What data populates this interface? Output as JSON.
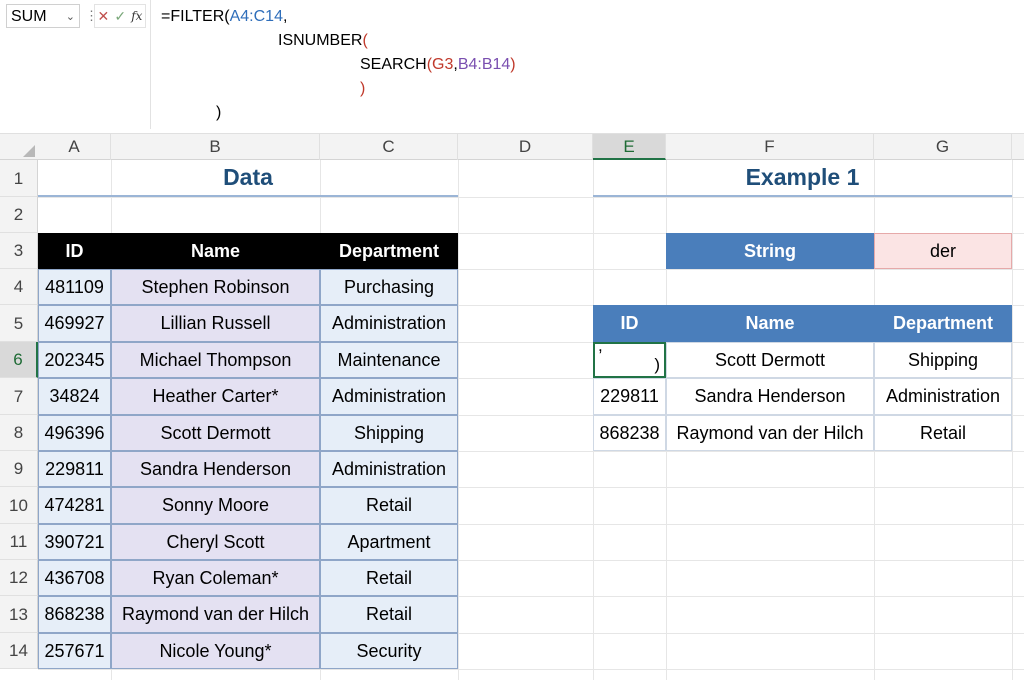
{
  "formula_bar": {
    "name_box": "SUM",
    "cancel_icon": "✕",
    "enter_icon": "✓",
    "fx_label": "fx",
    "formula_lines": {
      "l1a": "=FILTER(",
      "l1b": "A4:C14",
      "l1c": ",",
      "l2a": "ISNUMBER",
      "l2b": "(",
      "l3a": "SEARCH",
      "l3b": "(",
      "l3c": "G3",
      "l3d": ",",
      "l3e": "B4:B14",
      "l3f": ")",
      "l4": ")",
      "l5": ")"
    }
  },
  "columns": [
    "A",
    "B",
    "C",
    "D",
    "E",
    "F",
    "G"
  ],
  "selected_column": "E",
  "rows": [
    "1",
    "2",
    "3",
    "4",
    "5",
    "6",
    "7",
    "8",
    "9",
    "10",
    "11",
    "12",
    "13",
    "14"
  ],
  "selected_row": "6",
  "data_table": {
    "title": "Data",
    "headers": [
      "ID",
      "Name",
      "Department"
    ],
    "rows": [
      [
        "481109",
        "Stephen Robinson",
        "Purchasing"
      ],
      [
        "469927",
        "Lillian Russell",
        "Administration"
      ],
      [
        "202345",
        "Michael Thompson",
        "Maintenance"
      ],
      [
        "34824",
        "Heather Carter*",
        "Administration"
      ],
      [
        "496396",
        "Scott Dermott",
        "Shipping"
      ],
      [
        "229811",
        "Sandra Henderson",
        "Administration"
      ],
      [
        "474281",
        "Sonny Moore",
        "Retail"
      ],
      [
        "390721",
        "Cheryl Scott",
        "Apartment"
      ],
      [
        "436708",
        "Ryan Coleman*",
        "Retail"
      ],
      [
        "868238",
        "Raymond van der Hilch",
        "Retail"
      ],
      [
        "257671",
        "Nicole Young*",
        "Security"
      ]
    ]
  },
  "example": {
    "title": "Example 1",
    "string_label": "String",
    "string_value": "der",
    "headers": [
      "ID",
      "Name",
      "Department"
    ],
    "editing_cell_text_top": ",",
    "editing_cell_text_bottom": ")",
    "rows": [
      [
        "",
        "Scott Dermott",
        "Shipping"
      ],
      [
        "229811",
        "Sandra Henderson",
        "Administration"
      ],
      [
        "868238",
        "Raymond van der Hilch",
        "Retail"
      ]
    ]
  },
  "colors": {
    "title": "#1f4e79",
    "header_black": "#000000",
    "header_blue": "#4a7ebb",
    "id_fill": "#e6eef8",
    "name_fill": "#e4e1f2",
    "string_value_fill": "#fbe4e4",
    "selection": "#217346"
  }
}
